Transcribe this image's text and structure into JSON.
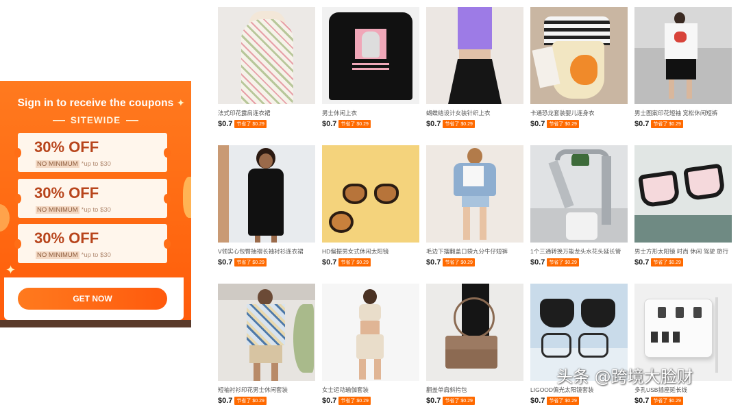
{
  "popup": {
    "title": "Sign in to receive the coupons",
    "subtitle": "SITEWIDE",
    "coupons": [
      {
        "amount": "30% OFF",
        "tag": "NO MINIMUM",
        "note": "*up to $30"
      },
      {
        "amount": "30% OFF",
        "tag": "NO MINIMUM",
        "note": "*up to $30"
      },
      {
        "amount": "30% OFF",
        "tag": "NO MINIMUM",
        "note": "*up to $30"
      }
    ],
    "cta": "GET NOW"
  },
  "products": [
    {
      "name": "法式印花露肩连衣裙",
      "price": "$0.7",
      "save": "节省了 $0.29"
    },
    {
      "name": "男士休闲上衣",
      "price": "$0.7",
      "save": "节省了 $0.29"
    },
    {
      "name": "蝴蝶结设计女装针织上衣",
      "price": "$0.7",
      "save": "节省了 $0.29"
    },
    {
      "name": "卡通恐龙套装婴儿连身衣",
      "price": "$0.7",
      "save": "节省了 $0.29"
    },
    {
      "name": "男士图案印花短袖 宽松休闲短裤",
      "price": "$0.7",
      "save": "节省了 $0.29"
    },
    {
      "name": "V领实心包臀抽褶长袖衬衫连衣裙",
      "price": "$0.7",
      "save": "节省了 $0.29"
    },
    {
      "name": "HD偏振男女式休闲太阳镜",
      "price": "$0.7",
      "save": "节省了 $0.29"
    },
    {
      "name": "毛边下摆翻盖口袋九分牛仔短裤",
      "price": "$0.7",
      "save": "节省了 $0.29"
    },
    {
      "name": "1个三通转换万能龙头水花头延长管",
      "price": "$0.7",
      "save": "节省了 $0.29"
    },
    {
      "name": "男士方形太阳镜 时尚 休闲 驾驶 旅行",
      "price": "$0.7",
      "save": "节省了 $0.29"
    },
    {
      "name": "短袖衬衫印花男士休闲套装",
      "price": "$0.7",
      "save": "节省了 $0.29"
    },
    {
      "name": "女士运动瑜伽套装",
      "price": "$0.7",
      "save": "节省了 $0.29"
    },
    {
      "name": "翻盖单肩斜挎包",
      "price": "$0.7",
      "save": "节省了 $0.29"
    },
    {
      "name": "LIGOOD偏光太阳镜套装",
      "price": "$0.7",
      "save": "节省了 $0.29"
    },
    {
      "name": "多孔USB插座延长线",
      "price": "$0.7",
      "save": "节省了 $0.29"
    }
  ],
  "watermark": {
    "text": "头条 @跨境大脸财",
    "sub": "跨境大脸财"
  }
}
